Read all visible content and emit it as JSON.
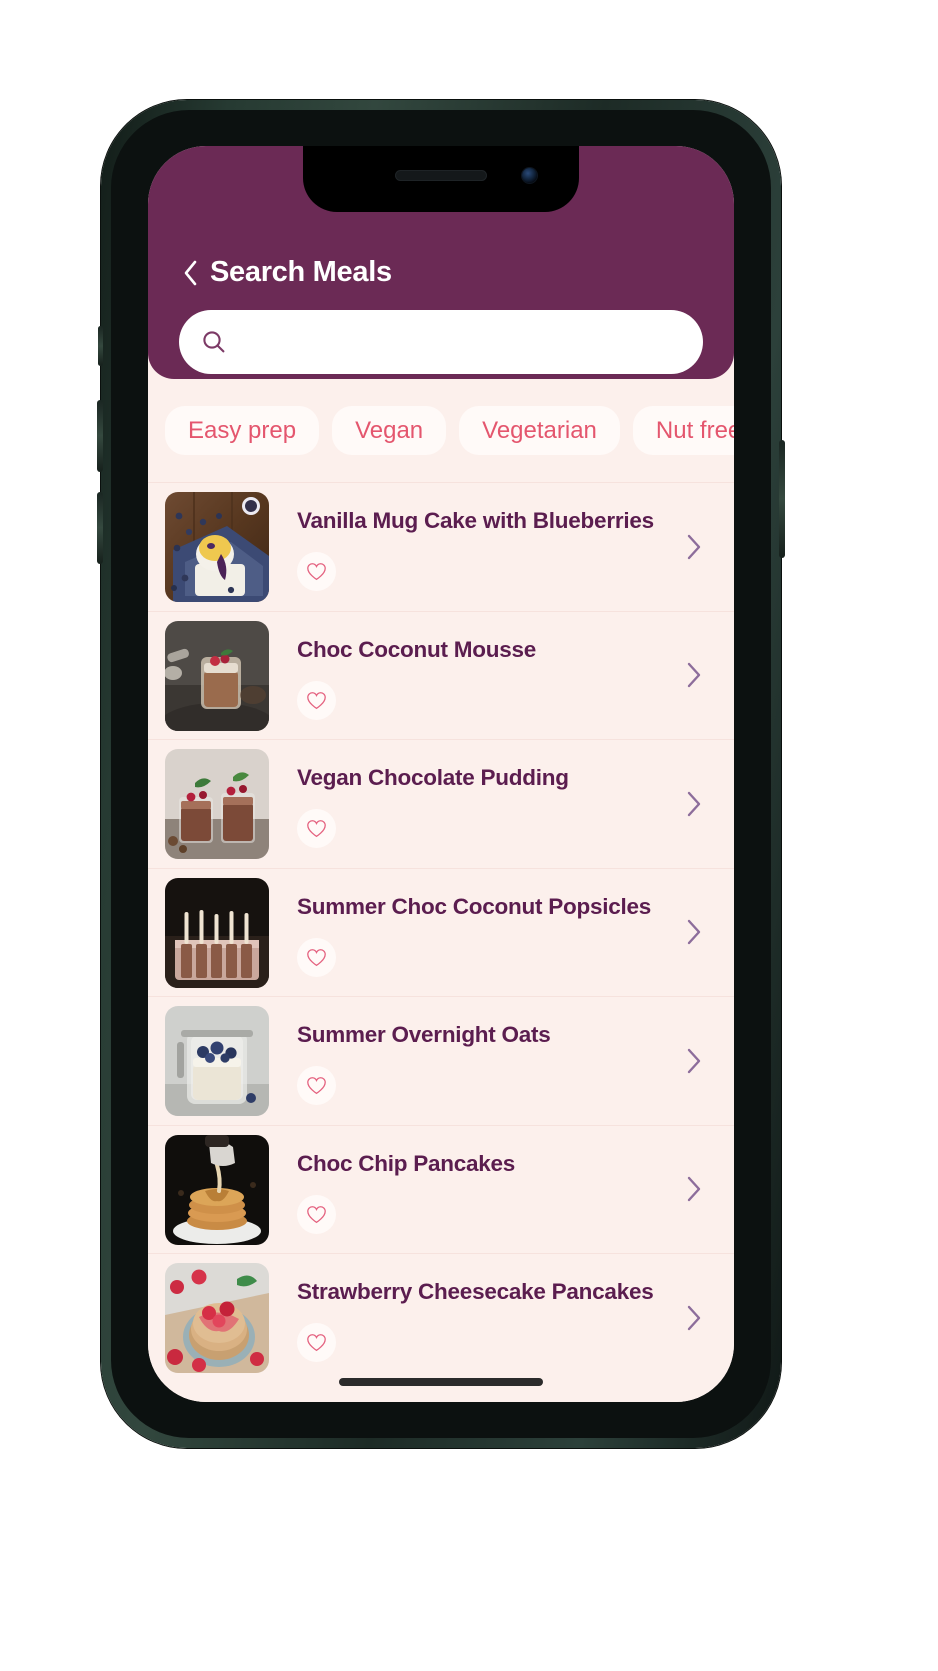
{
  "header": {
    "title": "Search Meals",
    "back_icon": "chevron-left-icon",
    "background_color": "#6B2A55",
    "title_color": "#FFFFFF"
  },
  "search": {
    "icon": "search-icon",
    "value": "",
    "placeholder": ""
  },
  "filters": {
    "chips": [
      {
        "label": "Easy prep",
        "selected": false
      },
      {
        "label": "Vegan",
        "selected": false
      },
      {
        "label": "Vegetarian",
        "selected": false
      },
      {
        "label": "Nut free",
        "selected": false
      }
    ],
    "chip_text_color": "#E4566E",
    "chip_background_color": "#FFFAF8"
  },
  "list": {
    "background_color": "#FCF0EC",
    "title_color": "#5B1D4F",
    "chevron_icon": "chevron-right-icon",
    "favorite_icon": "heart-outline-icon",
    "items": [
      {
        "title": "Vanilla Mug Cake with Blueberries",
        "favorited": false,
        "thumbnail": "vanilla-mug-cake-photo"
      },
      {
        "title": "Choc Coconut Mousse",
        "favorited": false,
        "thumbnail": "choc-coconut-mousse-photo"
      },
      {
        "title": "Vegan Chocolate Pudding",
        "favorited": false,
        "thumbnail": "vegan-chocolate-pudding-photo"
      },
      {
        "title": "Summer Choc Coconut Popsicles",
        "favorited": false,
        "thumbnail": "choc-coconut-popsicles-photo"
      },
      {
        "title": "Summer Overnight Oats",
        "favorited": false,
        "thumbnail": "summer-overnight-oats-photo"
      },
      {
        "title": "Choc Chip Pancakes",
        "favorited": false,
        "thumbnail": "choc-chip-pancakes-photo"
      },
      {
        "title": "Strawberry Cheesecake Pancakes",
        "favorited": false,
        "thumbnail": "strawberry-cheesecake-pancakes-photo"
      }
    ]
  },
  "device": {
    "frame_color": "#28392F",
    "home_indicator": true
  }
}
